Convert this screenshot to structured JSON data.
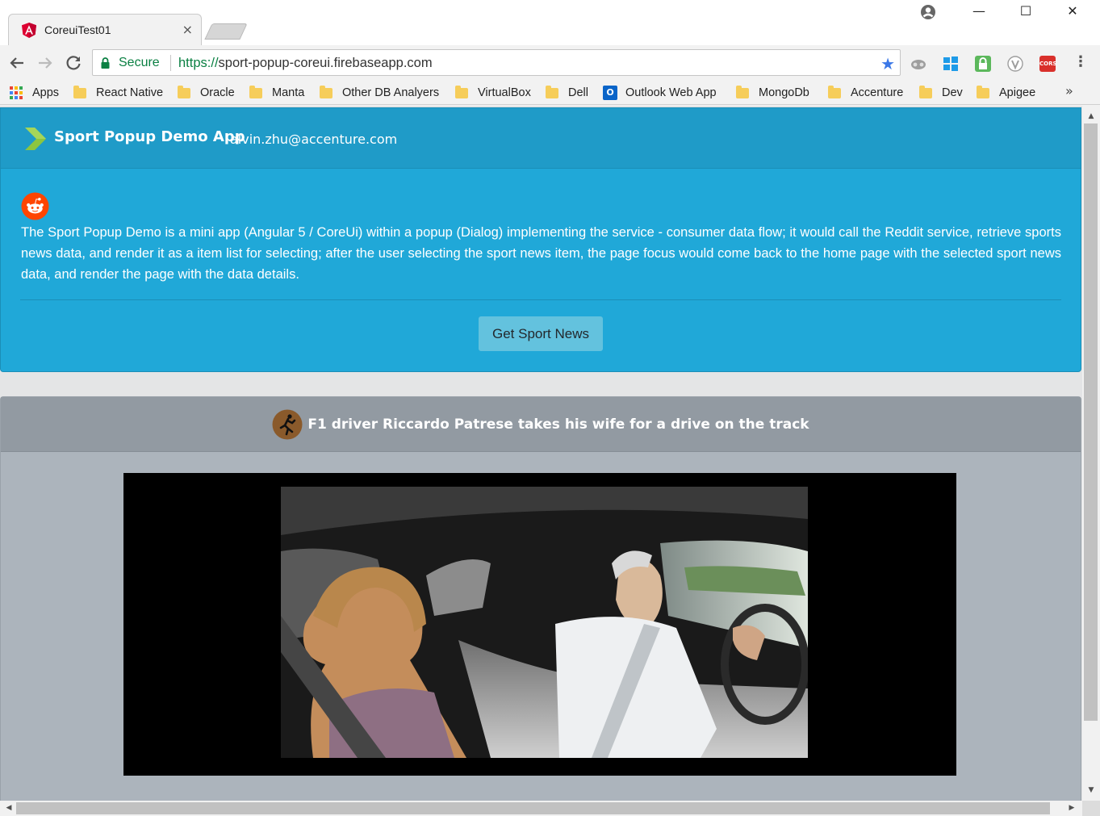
{
  "browser": {
    "tab_title": "CoreuiTest01",
    "tab_close": "×",
    "secure_label": "Secure",
    "url_scheme": "https://",
    "url_host": "sport-popup-coreui.firebaseapp.com",
    "window_minimize": "—",
    "window_maximize": "☐",
    "window_close": "✕",
    "bookmarks_more": "»",
    "bookmarks": [
      {
        "label": "Apps"
      },
      {
        "label": "React Native"
      },
      {
        "label": "Oracle"
      },
      {
        "label": "Manta"
      },
      {
        "label": "Other DB Analyers"
      },
      {
        "label": "VirtualBox"
      },
      {
        "label": "Dell"
      },
      {
        "label": "Outlook Web App"
      },
      {
        "label": "MongoDb"
      },
      {
        "label": "Accenture"
      },
      {
        "label": "Dev"
      },
      {
        "label": "Apigee"
      }
    ],
    "cors_badge": "CORS",
    "outlook_badge": "O"
  },
  "app": {
    "brand_name": "Sport Popup Demo App",
    "user_email": "alvin.zhu@accenture.com",
    "description": "The Sport Popup Demo is a mini app (Angular 5 / CoreUi) within a popup (Dialog) implementing the service - consumer data flow; it would call the Reddit service, retrieve sports news data, and render it as a item list for selecting; after the user selecting the sport news item, the page focus would come back to the home page with the selected sport news data, and render the page with the data details.",
    "button_label": "Get Sport News",
    "selected_news_title": "F1 driver Riccardo Patrese takes his wife for a drive on the track"
  },
  "colors": {
    "primary": "#20a8d8",
    "button_info": "#63c2de",
    "card_secondary": "#acb4bc",
    "reddit_orange": "#ff4500",
    "angular_red": "#dd0031"
  }
}
